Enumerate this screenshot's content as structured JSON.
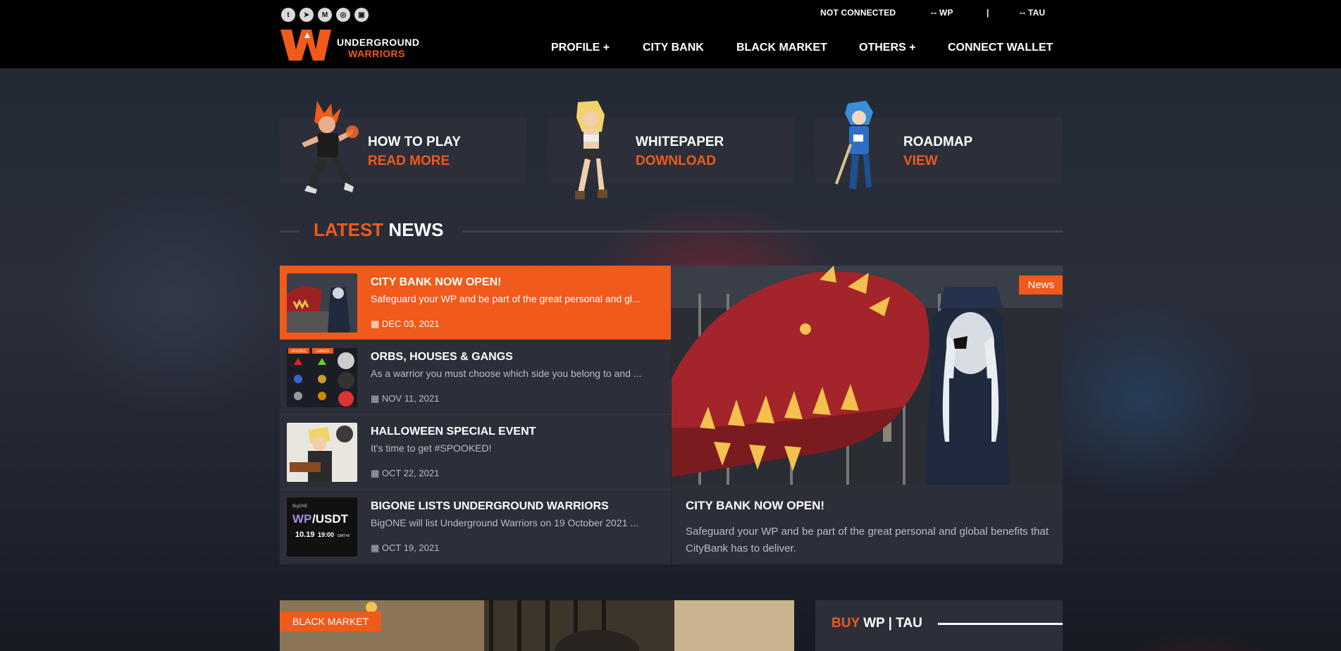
{
  "header": {
    "social": [
      {
        "name": "twitter-icon",
        "glyph": "t"
      },
      {
        "name": "telegram-icon",
        "glyph": "➤"
      },
      {
        "name": "medium-icon",
        "glyph": "M"
      },
      {
        "name": "instagram-icon",
        "glyph": "◎"
      },
      {
        "name": "discord-icon",
        "glyph": "▣"
      }
    ],
    "status": "NOT CONNECTED",
    "wp_balance": "-- WP",
    "separator": "|",
    "tau_balance": "-- TAU",
    "logo": {
      "line1": "UNDERGROUND",
      "line2": "WARRIORS"
    },
    "nav": [
      "PROFILE +",
      "CITY BANK",
      "BLACK MARKET",
      "OTHERS +",
      "CONNECT WALLET"
    ]
  },
  "cards": [
    {
      "title": "HOW TO PLAY",
      "action": "READ MORE"
    },
    {
      "title": "WHITEPAPER",
      "action": "DOWNLOAD"
    },
    {
      "title": "ROADMAP",
      "action": "VIEW"
    }
  ],
  "latest_news": {
    "title_highlight": "LATEST",
    "title_rest": "NEWS",
    "items": [
      {
        "title": "CITY BANK NOW OPEN!",
        "excerpt": "Safeguard your WP and be part of the great personal and gl...",
        "date": "DEC 03, 2021"
      },
      {
        "title": "ORBS, HOUSES & GANGS",
        "excerpt": "As a warrior you must choose which side you belong to and ...",
        "date": "NOV 11, 2021"
      },
      {
        "title": "HALLOWEEN SPECIAL EVENT",
        "excerpt": "It's time to get #SPOOKED!",
        "date": "OCT 22, 2021"
      },
      {
        "title": "BIGONE LISTS UNDERGROUND WARRIORS",
        "excerpt": "BigONE will list Underground Warriors on 19 October 2021 ...",
        "date": "OCT 19, 2021"
      }
    ],
    "thumb_texts": {
      "orbs_left": "HOUSES",
      "orbs_right": "GANGS",
      "bigone_brand": "BigONE",
      "bigone_pair_a": "WP",
      "bigone_pair_b": "/USDT",
      "bigone_date": "10.19",
      "bigone_time": "19:00",
      "bigone_tz": "GMT+8"
    }
  },
  "featured": {
    "badge": "News",
    "title": "CITY BANK NOW OPEN!",
    "excerpt": "Safeguard your WP and be part of the great personal and global benefits that CityBank has to deliver."
  },
  "black_market": {
    "badge": "BLACK MARKET"
  },
  "buy": {
    "highlight": "BUY",
    "rest": "WP | TAU"
  },
  "colors": {
    "accent": "#f05a1a",
    "panel": "#2c2f3a",
    "header": "#000000"
  }
}
